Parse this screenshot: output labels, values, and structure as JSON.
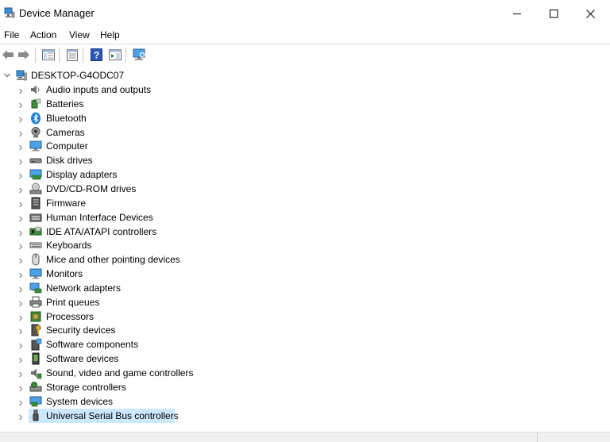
{
  "window": {
    "title": "Device Manager"
  },
  "menubar": {
    "items": [
      "File",
      "Action",
      "View",
      "Help"
    ]
  },
  "toolbar": {
    "buttons": [
      "back-arrow-icon",
      "forward-arrow-icon",
      "show-hide-console-tree-icon",
      "properties-icon",
      "help-icon",
      "action-pane-icon",
      "scan-hardware-icon"
    ]
  },
  "tree": {
    "root": {
      "label": "DESKTOP-G4ODC07",
      "icon": "computer-tower-icon",
      "expanded": true
    },
    "items": [
      {
        "label": "Audio inputs and outputs",
        "icon": "speaker-icon"
      },
      {
        "label": "Batteries",
        "icon": "battery-icon"
      },
      {
        "label": "Bluetooth",
        "icon": "bluetooth-icon"
      },
      {
        "label": "Cameras",
        "icon": "webcam-icon"
      },
      {
        "label": "Computer",
        "icon": "monitor-icon"
      },
      {
        "label": "Disk drives",
        "icon": "disk-drive-icon"
      },
      {
        "label": "Display adapters",
        "icon": "display-adapter-icon"
      },
      {
        "label": "DVD/CD-ROM drives",
        "icon": "dvd-drive-icon"
      },
      {
        "label": "Firmware",
        "icon": "firmware-icon"
      },
      {
        "label": "Human Interface Devices",
        "icon": "hid-icon"
      },
      {
        "label": "IDE ATA/ATAPI controllers",
        "icon": "ide-controller-icon"
      },
      {
        "label": "Keyboards",
        "icon": "keyboard-icon"
      },
      {
        "label": "Mice and other pointing devices",
        "icon": "mouse-icon"
      },
      {
        "label": "Monitors",
        "icon": "monitor-icon"
      },
      {
        "label": "Network adapters",
        "icon": "network-adapter-icon"
      },
      {
        "label": "Print queues",
        "icon": "printer-icon"
      },
      {
        "label": "Processors",
        "icon": "processor-icon"
      },
      {
        "label": "Security devices",
        "icon": "security-device-icon"
      },
      {
        "label": "Software components",
        "icon": "software-component-icon"
      },
      {
        "label": "Software devices",
        "icon": "software-device-icon"
      },
      {
        "label": "Sound, video and game controllers",
        "icon": "sound-controller-icon"
      },
      {
        "label": "Storage controllers",
        "icon": "storage-controller-icon"
      },
      {
        "label": "System devices",
        "icon": "system-device-icon"
      },
      {
        "label": "Universal Serial Bus controllers",
        "icon": "usb-icon",
        "selected": true
      }
    ]
  },
  "colors": {
    "selection": "#cce8ff",
    "accent_blue": "#1e7fd6",
    "toolbar_border": "#dcdcdc"
  }
}
